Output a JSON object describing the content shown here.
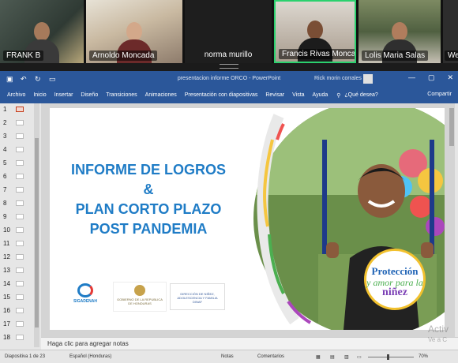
{
  "meeting": {
    "participants": [
      {
        "name": "FRANK B"
      },
      {
        "name": "Arnoldo Moncada"
      },
      {
        "name": "norma murillo"
      },
      {
        "name": "Francis Rivas Moncada"
      },
      {
        "name": "Lolis Maria Salas"
      },
      {
        "name": "Wen"
      }
    ]
  },
  "window": {
    "title": "presentacion informe ORCO  -  PowerPoint",
    "user": "Rick morin corrales",
    "controls": [
      "—",
      "▢",
      "✕"
    ]
  },
  "ribbon": {
    "tabs": [
      "Archivo",
      "Inicio",
      "Insertar",
      "Diseño",
      "Transiciones",
      "Animaciones",
      "Presentación con diapositivas",
      "Revisar",
      "Vista",
      "Ayuda"
    ],
    "tell_me": "¿Qué desea?",
    "share": "Compartir"
  },
  "thumbnails": {
    "numbers": [
      "1",
      "2",
      "3",
      "4",
      "5",
      "6",
      "7",
      "8",
      "9",
      "10",
      "11",
      "12",
      "13",
      "14",
      "15",
      "16",
      "17",
      "18"
    ],
    "active_index": 0
  },
  "slide": {
    "title_lines": [
      "INFORME DE LOGROS",
      "&",
      "PLAN CORTO PLAZO",
      "POST PANDEMIA"
    ],
    "logos": {
      "sigadenah": "SIGADENAH",
      "government": "GOBIERNO DE LA REPUBLICA DE HONDURAS",
      "directorate": "DIRECCIÓN DE NIÑEZ, ADOLESCENCIA Y FAMILIA DINAF"
    },
    "badge": {
      "line1": "Protección",
      "line2": "y amor para la",
      "line3": "niñez"
    }
  },
  "notes_placeholder": "Haga clic para agregar notas",
  "status": {
    "slide_count": "Diapositiva 1 de 23",
    "language": "Español (Honduras)",
    "notes": "Notas",
    "comments": "Comentarios",
    "zoom": "70%"
  },
  "watermark": {
    "line1": "Activ",
    "line2": "Ve a C"
  },
  "colors": {
    "ribbon": "#2b579a",
    "title": "#1f7cc6"
  }
}
